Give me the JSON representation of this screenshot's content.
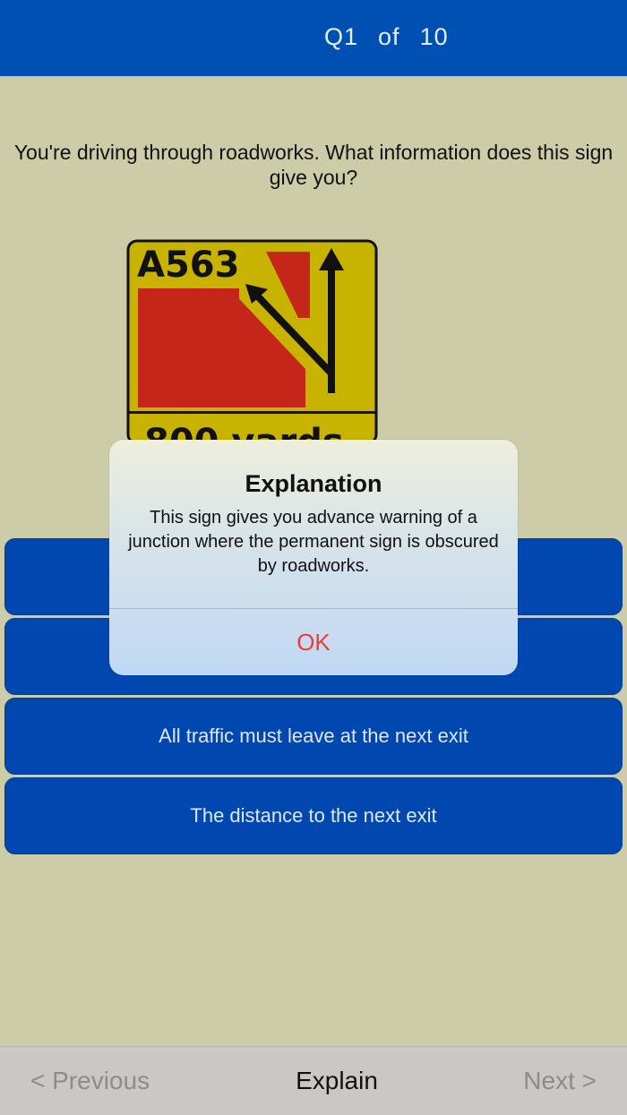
{
  "header": {
    "q_label": "Q1",
    "of_label": "of",
    "total": "10"
  },
  "question": {
    "text": "You're driving through roadworks. What information does this sign give you?"
  },
  "sign": {
    "road_number": "A563",
    "distance_text": "800 yards",
    "colors": {
      "background": "#c8b400",
      "red": "#c4261a",
      "border": "#111111"
    }
  },
  "answers": [
    {
      "label": ""
    },
    {
      "label": ""
    },
    {
      "label": "All traffic must leave at the next exit"
    },
    {
      "label": "The distance to the next exit"
    }
  ],
  "alert": {
    "title": "Explanation",
    "body": "This sign gives you advance warning of a junction where the permanent sign is obscured by roadworks.",
    "ok_label": "OK"
  },
  "footer": {
    "previous_label": "< Previous",
    "explain_label": "Explain",
    "next_label": "Next >"
  },
  "colors": {
    "header": "#0050b4",
    "background": "#cdcca8",
    "answer": "#0048b0",
    "alert_button": "#f23b30"
  }
}
